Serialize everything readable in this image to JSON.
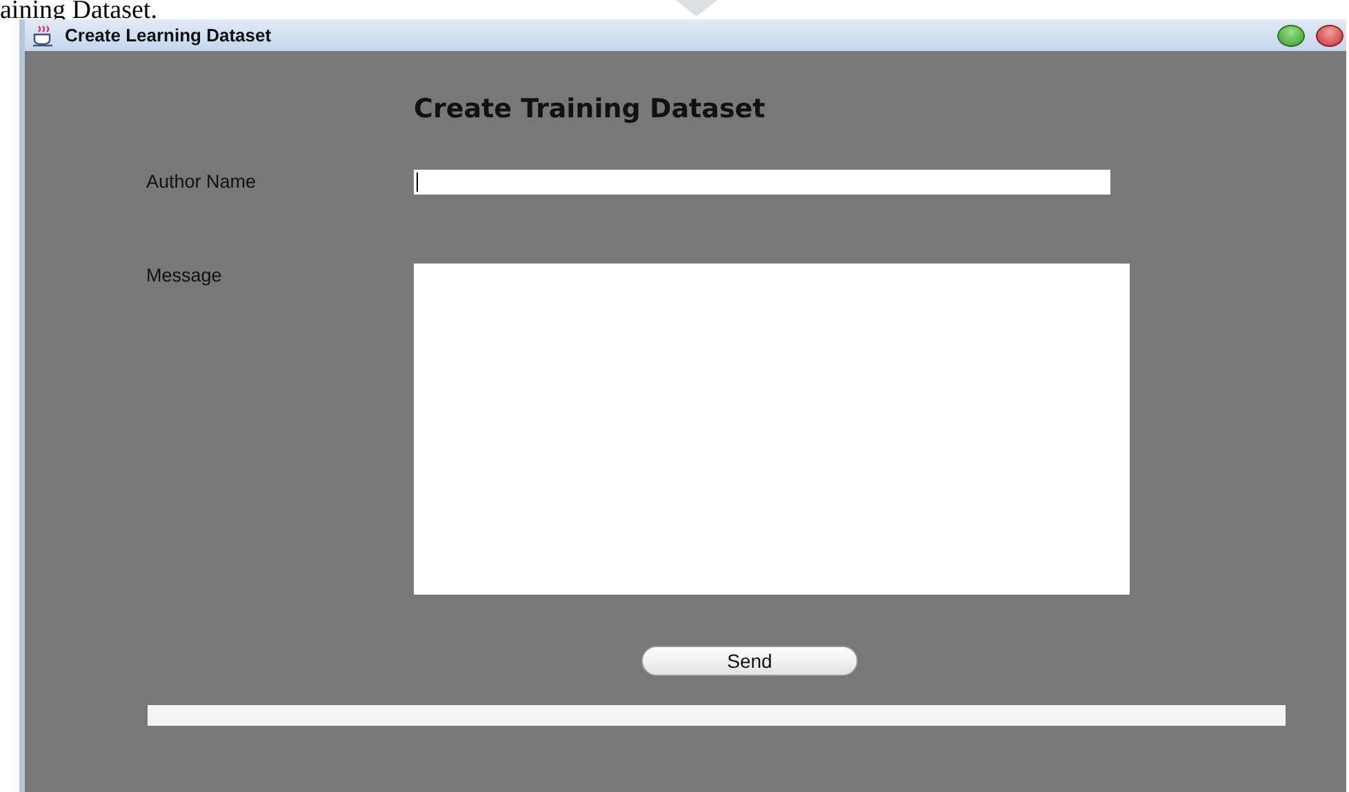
{
  "document_fragment": "aining Dataset.",
  "window": {
    "title": "Create Learning Dataset"
  },
  "heading": "Create Training Dataset",
  "fields": [
    {
      "kind": "line",
      "label": "Author Name",
      "focused": true
    },
    {
      "kind": "area",
      "label": "Message",
      "focused": false
    }
  ],
  "send_button": "Send"
}
